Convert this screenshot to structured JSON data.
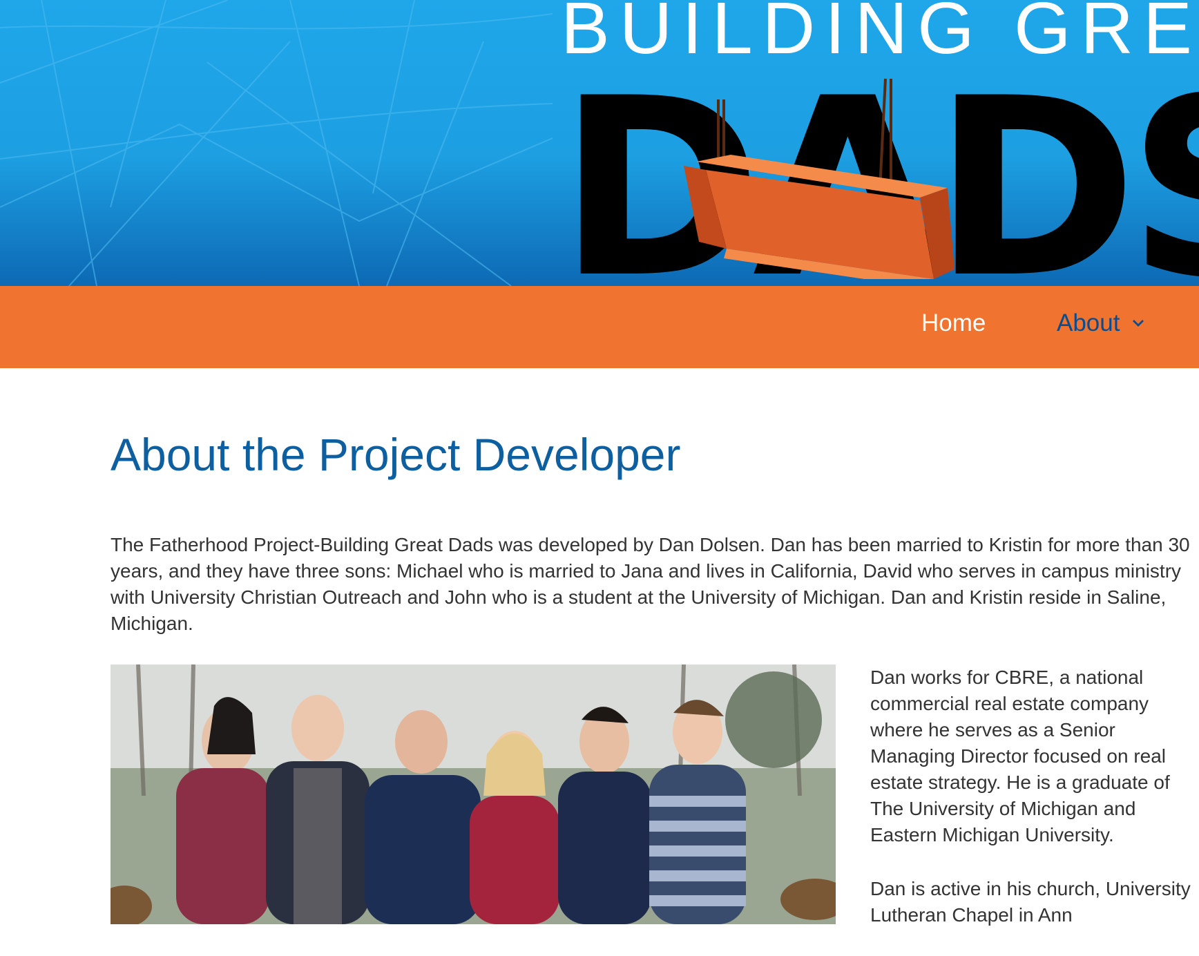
{
  "banner": {
    "logo_line1": "BUILDING GRE",
    "logo_line2": "DADS",
    "colors": {
      "sky": "#1fa7ea",
      "deep": "#0d69b4",
      "beam": "#f07430",
      "text_black": "#000000"
    }
  },
  "nav": {
    "items": [
      {
        "label": "Home",
        "color": "#ffffff"
      },
      {
        "label": "About",
        "color": "#0d4c8c",
        "has_dropdown": true
      }
    ],
    "background": "#f07430"
  },
  "page": {
    "title": "About the Project Developer",
    "intro": "The Fatherhood Project-Building Great Dads was developed by Dan Dolsen. Dan has been married to Kristin for more than 30 years, and they have three sons: Michael who is married to Jana and lives in California, David who serves in campus ministry with University Christian Outreach and John who is a student at the University of Michigan. Dan and Kristin reside in Saline, Michigan.",
    "side_paragraphs": [
      "Dan works for CBRE, a national commercial real estate company where he serves as a Senior Managing Director focused on real estate strategy. He is a graduate of The University of Michigan and Eastern Michigan University.",
      "Dan is active in his church, University Lutheran Chapel in Ann"
    ],
    "photo_icon": "family-photo"
  }
}
